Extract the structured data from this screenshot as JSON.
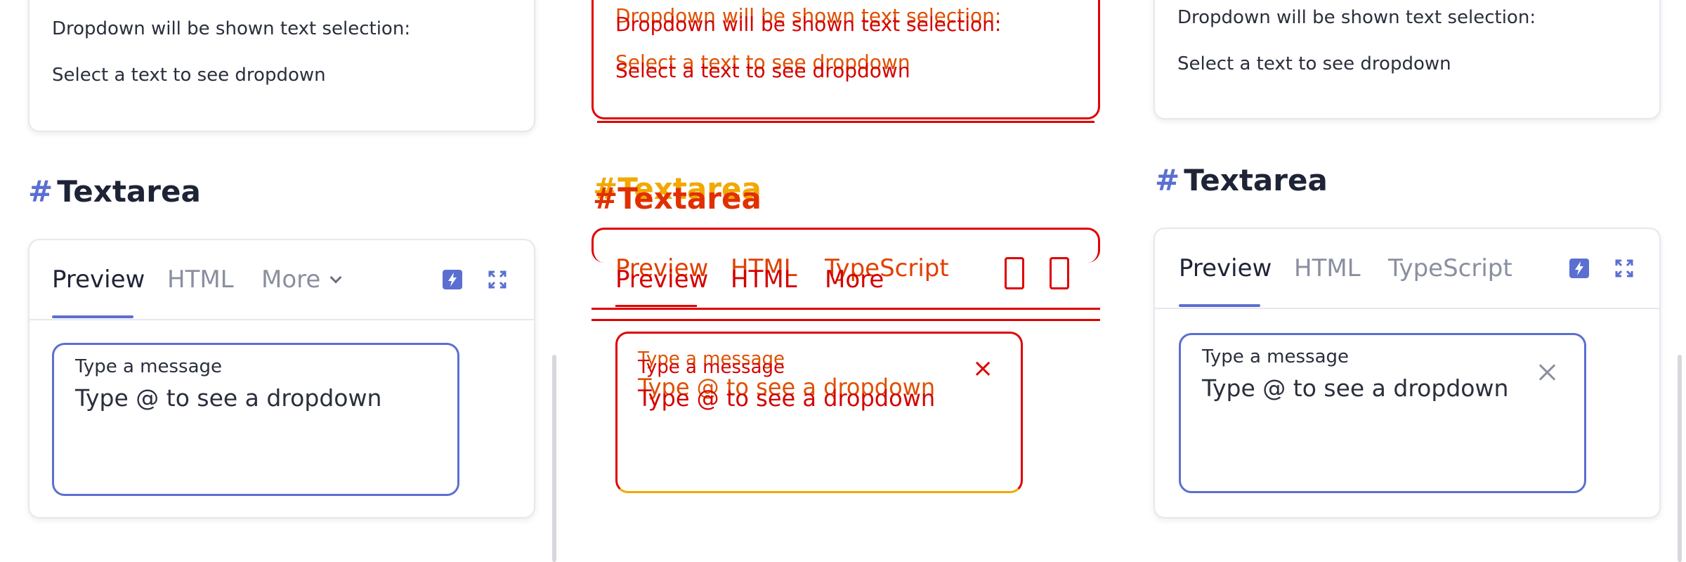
{
  "left": {
    "snippet": {
      "line1": "Dropdown will be shown text selection:",
      "line2": "Select a text to see dropdown"
    },
    "heading": {
      "hash": "#",
      "title": "Textarea"
    },
    "tabs": [
      "Preview",
      "HTML",
      "More"
    ],
    "field": {
      "label": "Type a message",
      "value": "Type @ to see a dropdown"
    }
  },
  "middle": {
    "snippet": {
      "line1": "Dropdown will be shown text selection:",
      "line2": "Select a text to see dropdown"
    },
    "heading": {
      "hash": "#",
      "title": "Textarea"
    },
    "tabs_top": [
      "Preview",
      "HTML",
      "TypeScript"
    ],
    "tabs_bottom": [
      "Preview",
      "HTML",
      "More"
    ],
    "field": {
      "label": "Type a message",
      "value": "Type @ to see a dropdown",
      "clear": "×"
    }
  },
  "right": {
    "snippet": {
      "line1": "Dropdown will be shown text selection:",
      "line2": "Select a text to see dropdown"
    },
    "heading": {
      "hash": "#",
      "title": "Textarea"
    },
    "tabs": [
      "Preview",
      "HTML",
      "TypeScript"
    ],
    "field": {
      "label": "Type a message",
      "value": "Type @ to see a dropdown"
    }
  },
  "colors": {
    "accent": "#5b6fd1",
    "diff_red": "#e00000",
    "diff_yellow": "#f2a800"
  },
  "icons": [
    "bolt-icon",
    "expand-icon",
    "chevron-down-icon",
    "close-icon"
  ]
}
